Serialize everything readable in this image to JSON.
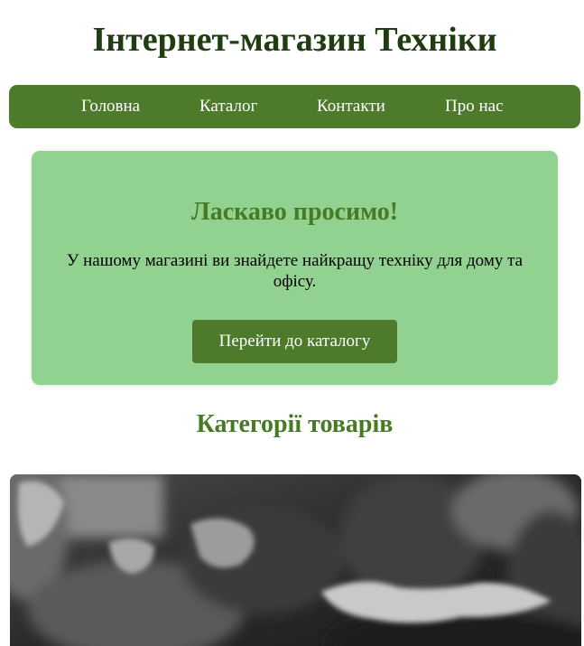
{
  "header": {
    "title": "Інтернет-магазин Техніки"
  },
  "nav": {
    "items": [
      {
        "label": "Головна"
      },
      {
        "label": "Каталог"
      },
      {
        "label": "Контакти"
      },
      {
        "label": "Про нас"
      }
    ]
  },
  "hero": {
    "title": "Ласкаво просимо!",
    "text": "У нашому магазині ви знайдете найкращу техніку для дому та офісу.",
    "button_label": "Перейти до каталогу"
  },
  "categories": {
    "title": "Категорії товарів"
  },
  "colors": {
    "title": "#1f3d10",
    "nav_background": "#4e7a2c",
    "hero_background": "#92d291",
    "heading_green": "#467a25"
  }
}
